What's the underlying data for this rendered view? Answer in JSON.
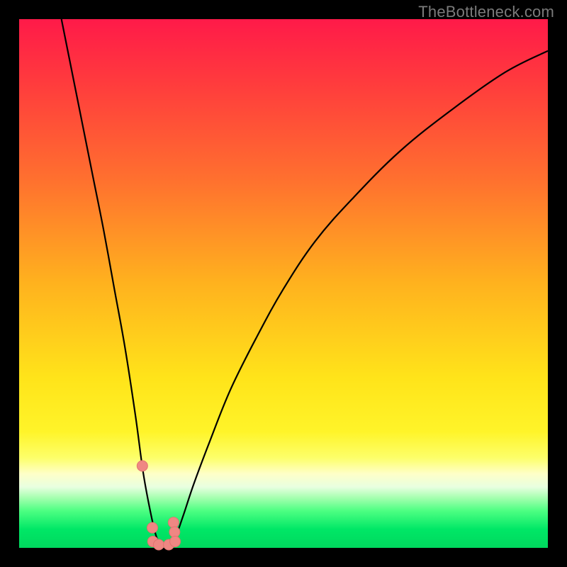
{
  "watermark": "TheBottleneck.com",
  "colors": {
    "frame": "#000000",
    "curve": "#000000",
    "marker_fill": "#ef8783",
    "marker_stroke": "#e2736f",
    "gradient_stops": [
      {
        "offset": 0.0,
        "color": "#ff1a49"
      },
      {
        "offset": 0.12,
        "color": "#ff3b3d"
      },
      {
        "offset": 0.3,
        "color": "#ff6f2f"
      },
      {
        "offset": 0.5,
        "color": "#ffb21e"
      },
      {
        "offset": 0.68,
        "color": "#ffe41a"
      },
      {
        "offset": 0.78,
        "color": "#fff429"
      },
      {
        "offset": 0.83,
        "color": "#fdff6a"
      },
      {
        "offset": 0.86,
        "color": "#feffc8"
      },
      {
        "offset": 0.885,
        "color": "#e8ffe0"
      },
      {
        "offset": 0.905,
        "color": "#a6ffb0"
      },
      {
        "offset": 0.93,
        "color": "#4dff82"
      },
      {
        "offset": 0.965,
        "color": "#00e766"
      },
      {
        "offset": 1.0,
        "color": "#00d85e"
      }
    ]
  },
  "chart_data": {
    "type": "line",
    "title": "",
    "xlabel": "",
    "ylabel": "",
    "xlim": [
      0,
      100
    ],
    "ylim": [
      0,
      100
    ],
    "series": [
      {
        "name": "bottleneck-curve",
        "x": [
          8,
          10,
          12,
          14,
          16,
          18,
          20,
          22,
          23.5,
          25,
          26,
          27,
          28,
          29.5,
          31,
          33,
          36,
          40,
          45,
          50,
          56,
          63,
          72,
          82,
          92,
          100
        ],
        "values": [
          100,
          90,
          80,
          70,
          60,
          49,
          38,
          25,
          14,
          6,
          2,
          0.5,
          0.5,
          2,
          6,
          12,
          20,
          30,
          40,
          49,
          58,
          66,
          75,
          83,
          90,
          94
        ]
      }
    ],
    "markers": {
      "name": "highlighted-points",
      "x": [
        23.3,
        25.2,
        25.3,
        26.4,
        28.3,
        29.2,
        29.4,
        29.5
      ],
      "values": [
        15.5,
        3.8,
        1.2,
        0.6,
        0.6,
        4.8,
        3.0,
        1.2
      ]
    }
  }
}
